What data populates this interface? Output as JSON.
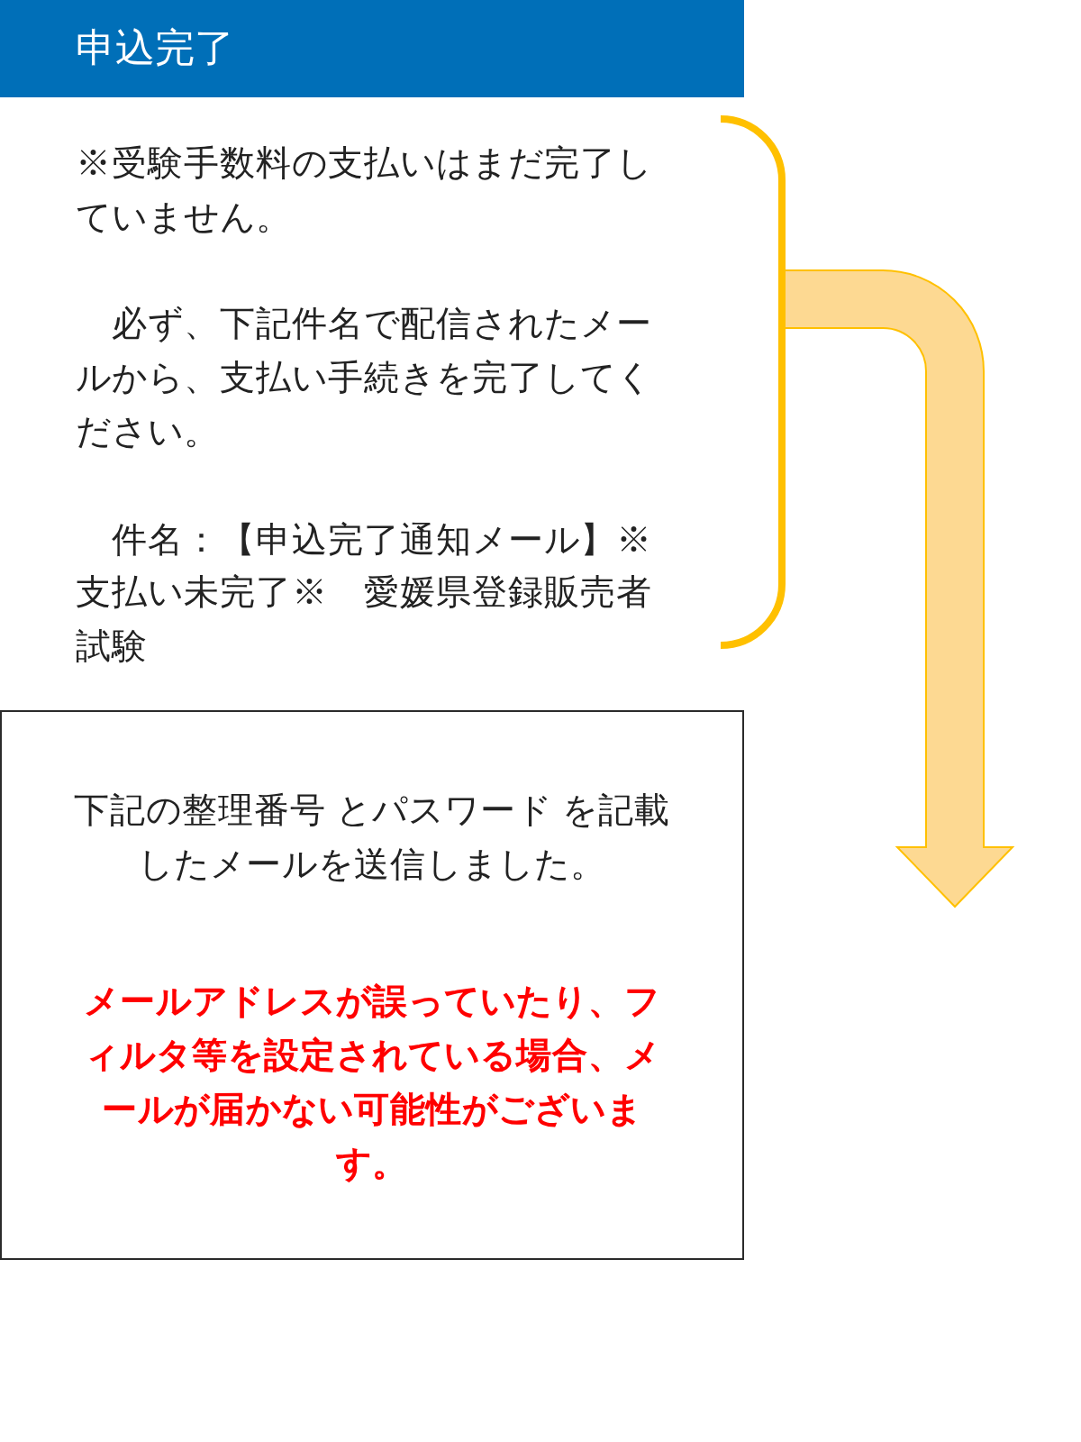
{
  "header": {
    "title": "申込完了"
  },
  "notice": {
    "paragraphs": [
      "※受験手数料の支払いはまだ完了していません。",
      "　必ず、下記件名で配信されたメールから、支払い手続きを完了してください。",
      "　件名：【申込完了通知メール】※支払い未完了※　愛媛県登録販売者試験"
    ]
  },
  "message_box": {
    "paragraphs": [
      {
        "kind": "info",
        "text": "下記の整理番号 とパスワード を記載したメールを送信しました。"
      },
      {
        "kind": "warning",
        "text": "メールアドレスが誤っていたり、フィルタ等を設定されている場合、メールが届かない可能性がございます。"
      }
    ]
  }
}
